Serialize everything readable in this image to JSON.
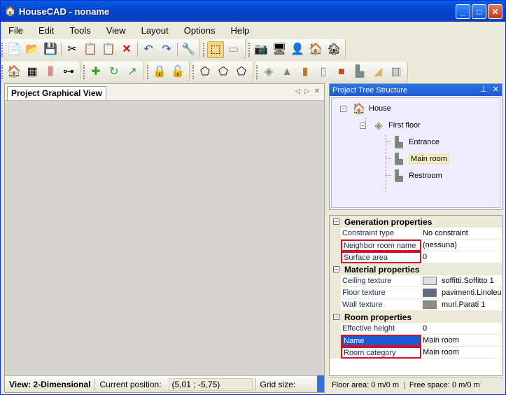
{
  "window": {
    "title": "HouseCAD - noname",
    "controls": [
      "_",
      "□",
      "✕"
    ]
  },
  "menu": [
    "File",
    "Edit",
    "Tools",
    "View",
    "Layout",
    "Options",
    "Help"
  ],
  "toolbar1": [
    [
      "new-file-icon",
      "open-folder-icon",
      "save-icon"
    ],
    [
      "cut-icon",
      "copy-icon",
      "paste-icon",
      "delete-icon"
    ],
    [
      "undo-icon",
      "redo-icon"
    ],
    [
      "wrench-icon"
    ],
    [
      "select-pointer-icon",
      "ruler-icon"
    ],
    [
      "camera-icon",
      "monitor-preview-icon",
      "user-house-icon",
      "house-settings-icon",
      "house-remove-icon"
    ]
  ],
  "toolbar2": [
    [
      "house-add-icon",
      "grid-table-icon",
      "columns-icon",
      "node-graph-icon"
    ],
    [
      "move-cross-icon",
      "rotate-icon",
      "resize-arrow-icon"
    ],
    [
      "lock-icon",
      "unlock-icon"
    ],
    [
      "polygon-add-icon",
      "polygon-copy-icon",
      "polygon-edit-icon"
    ],
    [
      "floor-icon",
      "roof-icon",
      "door-icon",
      "window-icon",
      "cabinet-icon",
      "wall-icon",
      "stairs-icon",
      "room-icon"
    ]
  ],
  "left_panel": {
    "tab": "Project Graphical View",
    "status": {
      "view": "View: 2-Dimensional",
      "position_label": "Current position:",
      "position_value": "(5,01 ; -5,75)",
      "grid_label": "Grid size:"
    }
  },
  "tree_panel": {
    "title": "Project Tree Structure",
    "root": "House",
    "floor": "First floor",
    "rooms": [
      "Entrance",
      "Main room",
      "Restroom"
    ],
    "selected": "Main room"
  },
  "properties": {
    "categories": [
      {
        "name": "Generation properties",
        "rows": [
          {
            "name": "Constraint type",
            "value": "No constraint"
          },
          {
            "name": "Neighbor room name",
            "value": "(nessuna)",
            "highlight": true
          },
          {
            "name": "Surface area",
            "value": "0",
            "highlight": true
          }
        ]
      },
      {
        "name": "Material properties",
        "rows": [
          {
            "name": "Ceiling texture",
            "value": "soffitti.Soffitto 1",
            "swatch": "#e0e0e0"
          },
          {
            "name": "Floor texture",
            "value": "pavimenti.Linoleum",
            "swatch": "#5f6c7e"
          },
          {
            "name": "Wall texture",
            "value": "muri.Parati 1",
            "swatch": "#8c8f80"
          }
        ]
      },
      {
        "name": "Room properties",
        "rows": [
          {
            "name": "Effective height",
            "value": "0"
          },
          {
            "name": "Name",
            "value": "Main room",
            "selected": true
          },
          {
            "name": "Room category",
            "value": "Main room",
            "highlight": true
          }
        ]
      }
    ]
  },
  "right_status": {
    "floor_area": "Floor area: 0 m/0 m",
    "free_space": "Free space: 0 m/0 m"
  },
  "colors": {
    "title_blue": "#0346d0",
    "highlight_red": "#d40f2a",
    "selection_blue": "#1c5ad2"
  }
}
